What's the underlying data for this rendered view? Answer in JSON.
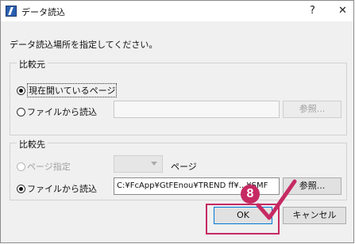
{
  "window": {
    "title": "データ読込",
    "help_glyph": "?",
    "close_glyph": "✕"
  },
  "instruction": "データ読込場所を指定してください。",
  "source_group": {
    "label": "比較元",
    "option_current": "現在開いているページ",
    "option_file": "ファイルから読込",
    "file_path": "",
    "browse_label": "参照..."
  },
  "dest_group": {
    "label": "比較先",
    "option_page": "ページ指定",
    "page_value": "",
    "page_suffix": "ページ",
    "option_file": "ファイルから読込",
    "file_path": "C:¥FcApp¥GtFEnou¥TREND ff¥...¥SMF",
    "browse_label": "参照..."
  },
  "buttons": {
    "ok_label": "OK",
    "cancel_label": "キャンセル"
  },
  "annotation": {
    "step_number": "8",
    "accent_color": "#c62a62"
  }
}
